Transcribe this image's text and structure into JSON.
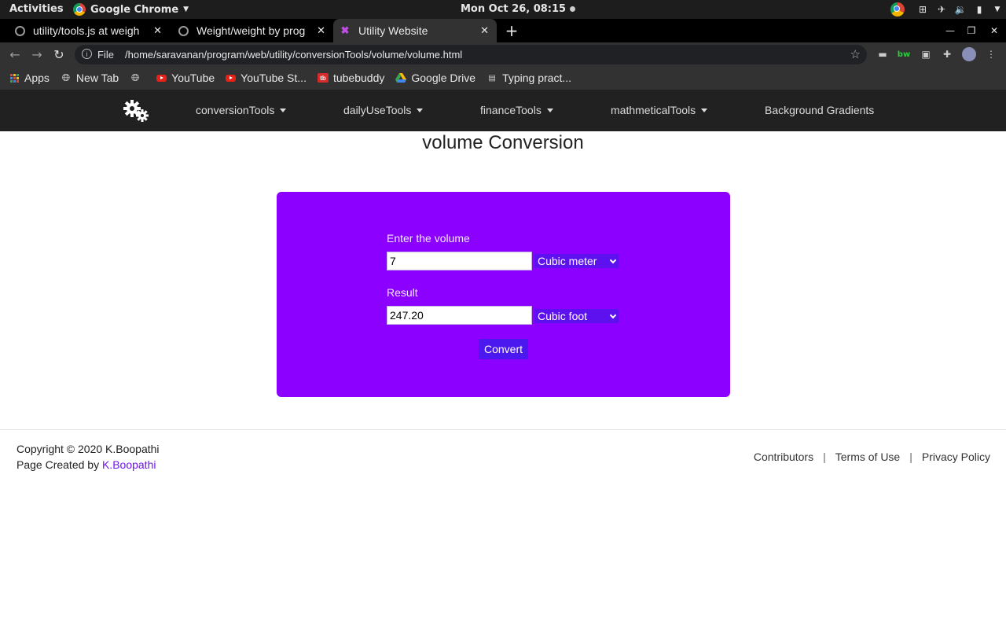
{
  "os_bar": {
    "activities": "Activities",
    "app_name": "Google Chrome",
    "clock": "Mon Oct 26, 08:15"
  },
  "tabs": [
    {
      "title": "utility/tools.js at weigh",
      "active": false
    },
    {
      "title": "Weight/weight by prog",
      "active": false
    },
    {
      "title": "Utility Website",
      "active": true
    }
  ],
  "address_bar": {
    "scheme": "File",
    "url": "/home/saravanan/program/web/utility/conversionTools/volume/volume.html"
  },
  "bookmarks": [
    {
      "label": "Apps",
      "icon": "apps-grid-icon"
    },
    {
      "label": "New Tab",
      "icon": "globe-icon"
    },
    {
      "label": "",
      "icon": "globe-icon"
    },
    {
      "label": "YouTube",
      "icon": "youtube-icon"
    },
    {
      "label": "YouTube St...",
      "icon": "youtube-icon"
    },
    {
      "label": "tubebuddy",
      "icon": "tubebuddy-icon"
    },
    {
      "label": "Google Drive",
      "icon": "google-drive-icon"
    },
    {
      "label": "Typing pract...",
      "icon": "page-icon"
    }
  ],
  "site_nav": {
    "logo_icon": "gears-icon",
    "items": [
      {
        "label": "conversionTools",
        "dropdown": true
      },
      {
        "label": "dailyUseTools",
        "dropdown": true
      },
      {
        "label": "financeTools",
        "dropdown": true
      },
      {
        "label": "mathmeticalTools",
        "dropdown": true
      },
      {
        "label": "Background Gradients",
        "dropdown": false
      }
    ]
  },
  "main": {
    "title": "volume Conversion",
    "input_label": "Enter the volume",
    "input_value": "7",
    "input_unit": "Cubic meter",
    "result_label": "Result",
    "result_value": "247.20",
    "result_unit": "Cubic foot",
    "convert_label": "Convert",
    "card_color": "#8b00ff"
  },
  "footer": {
    "copyright": "Copyright © 2020 K.Boopathi",
    "created_prefix": "Page Created by ",
    "created_author": "K.Boopathi",
    "links": [
      "Contributors",
      "Terms of Use",
      "Privacy Policy"
    ],
    "separator": "|"
  }
}
